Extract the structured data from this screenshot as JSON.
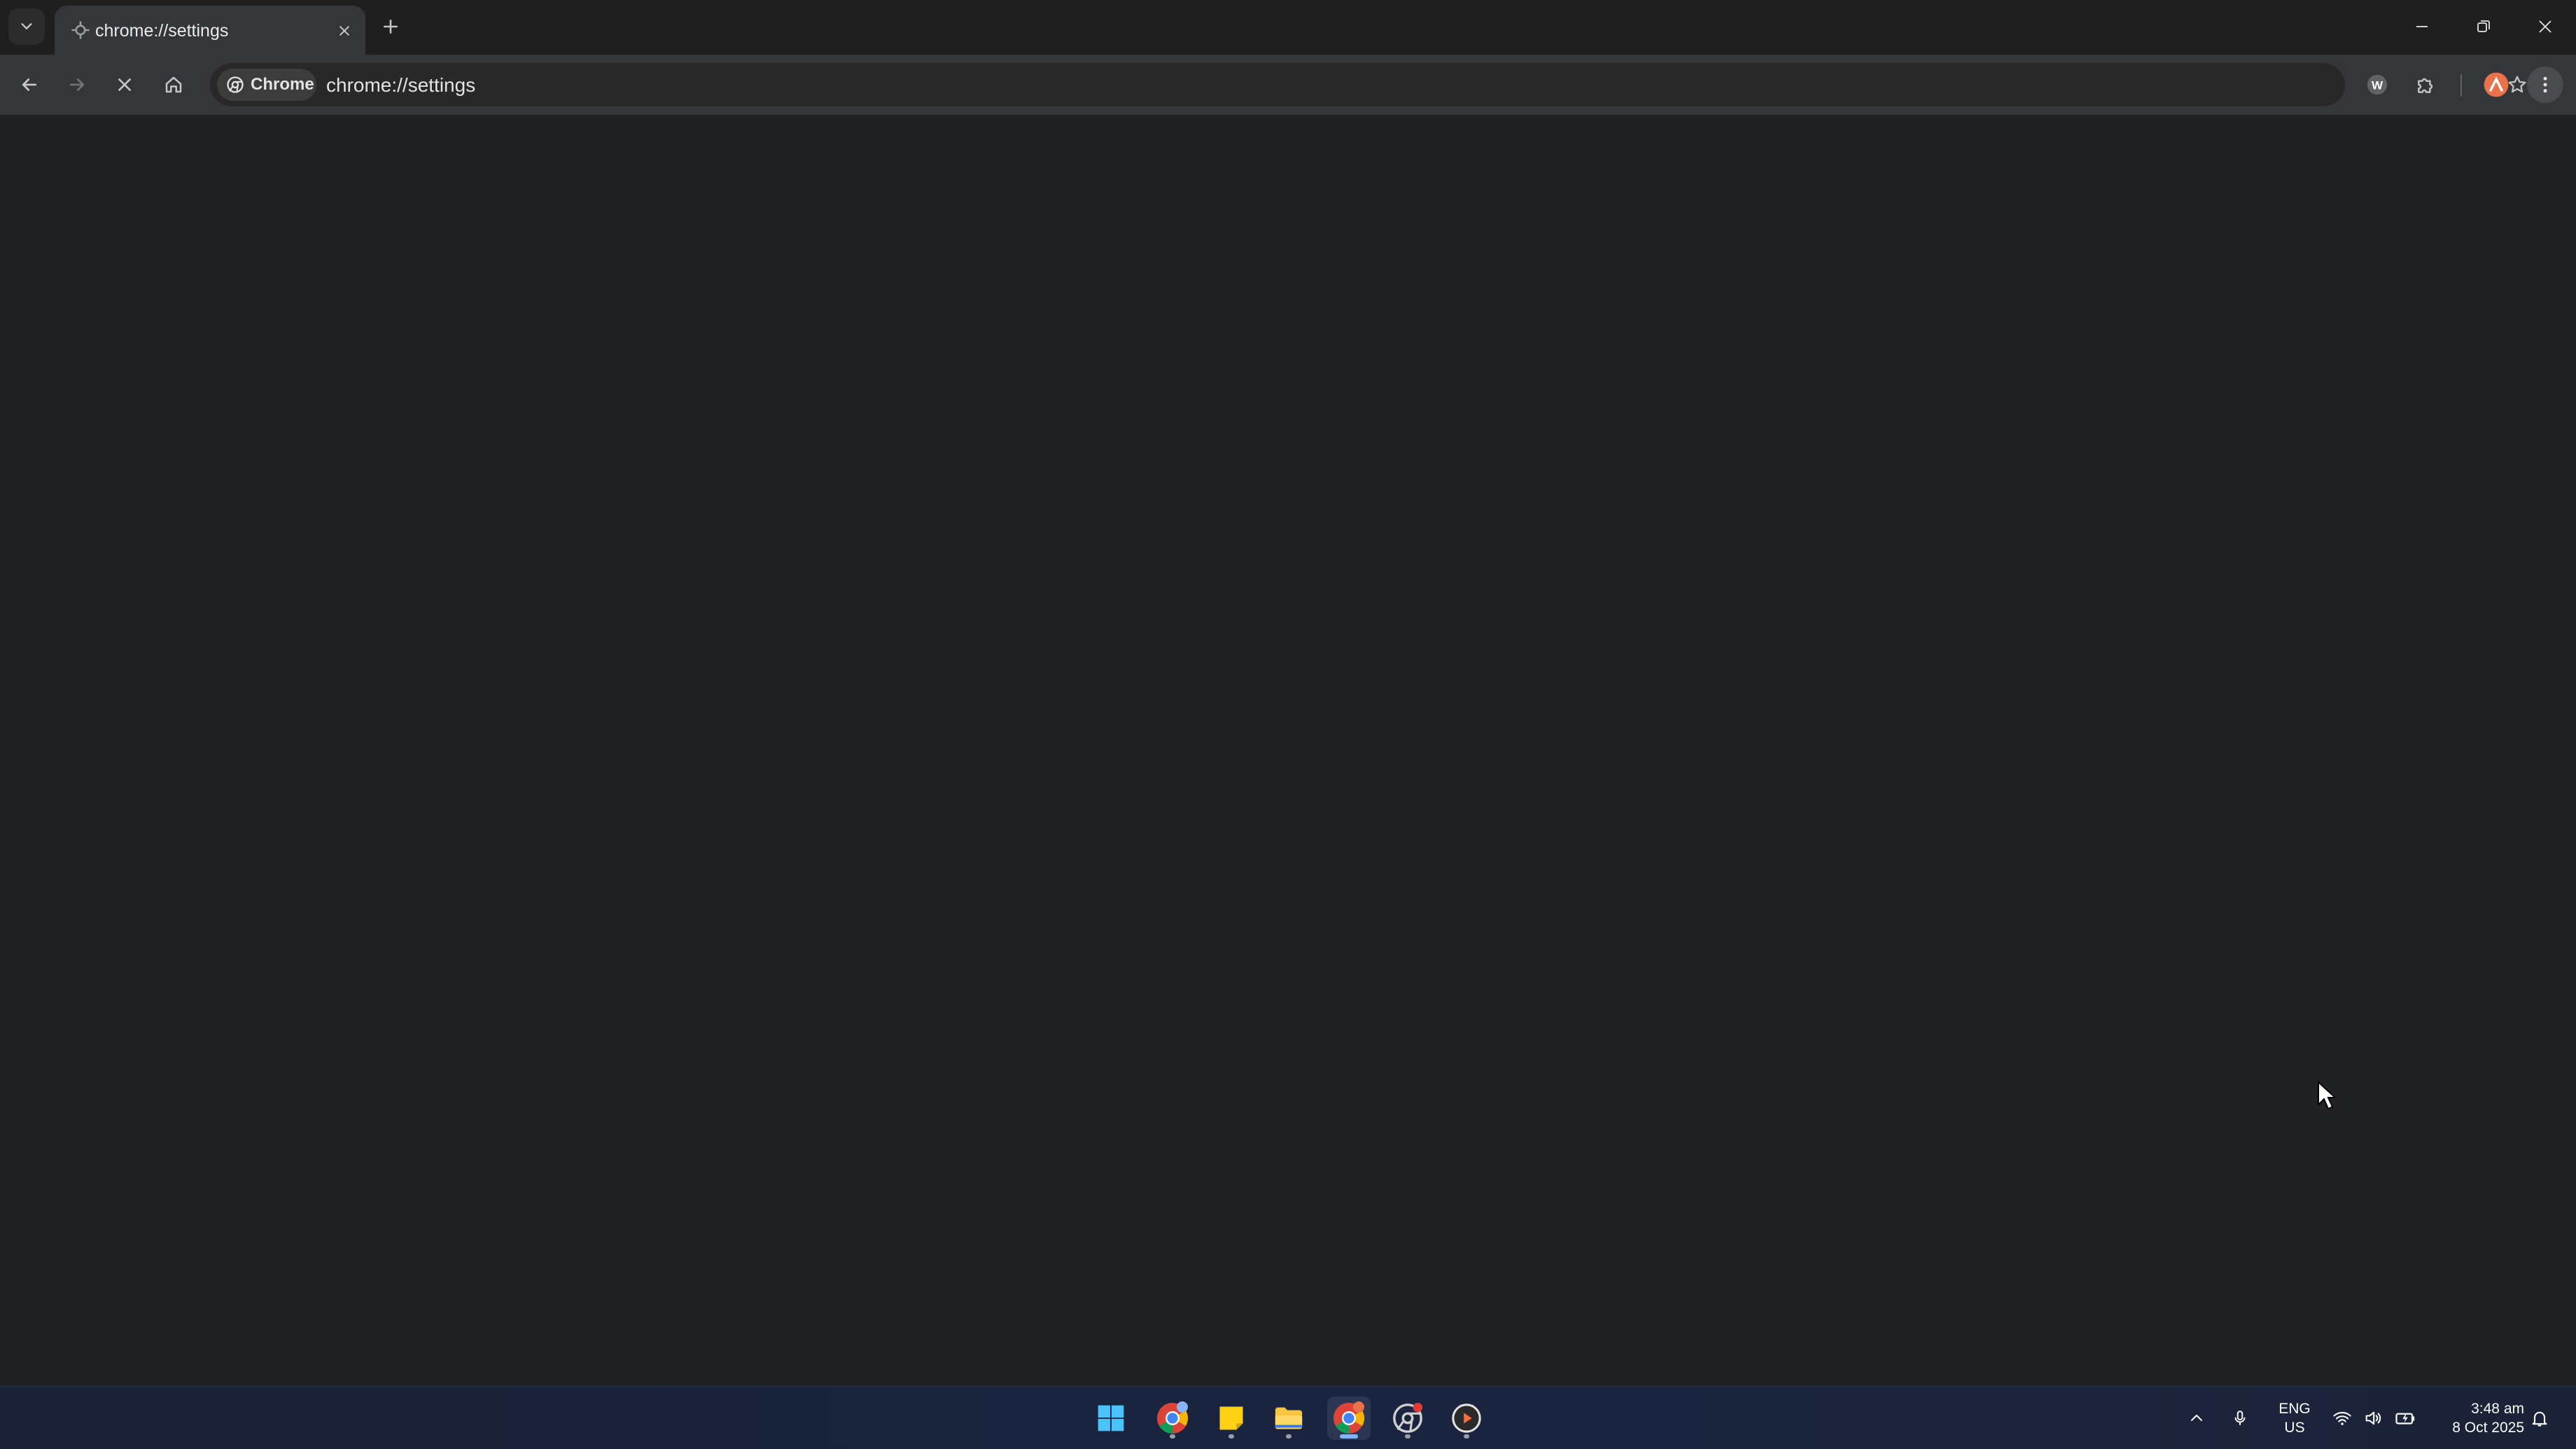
{
  "tab": {
    "title": "chrome://settings",
    "favicon": "chrome-settings-icon"
  },
  "toolbar": {
    "chip_label": "Chrome",
    "url": "chrome://settings",
    "accent_color": "#a8c7fa"
  },
  "taskbar": {
    "apps": [
      {
        "name": "start-button",
        "icon": "windows-logo-icon"
      },
      {
        "name": "chrome-profile-app",
        "icon": "chrome-icon"
      },
      {
        "name": "sticky-notes-app",
        "icon": "sticky-notes-icon"
      },
      {
        "name": "file-explorer-app",
        "icon": "folder-icon"
      },
      {
        "name": "chrome-app",
        "icon": "chrome-icon",
        "active": true
      },
      {
        "name": "chrome-alt-app",
        "icon": "chrome-outline-icon"
      },
      {
        "name": "media-player-app",
        "icon": "play-icon"
      }
    ],
    "lang_line1": "ENG",
    "lang_line2": "US",
    "time": "3:48 am",
    "date": "8 Oct 2025"
  }
}
